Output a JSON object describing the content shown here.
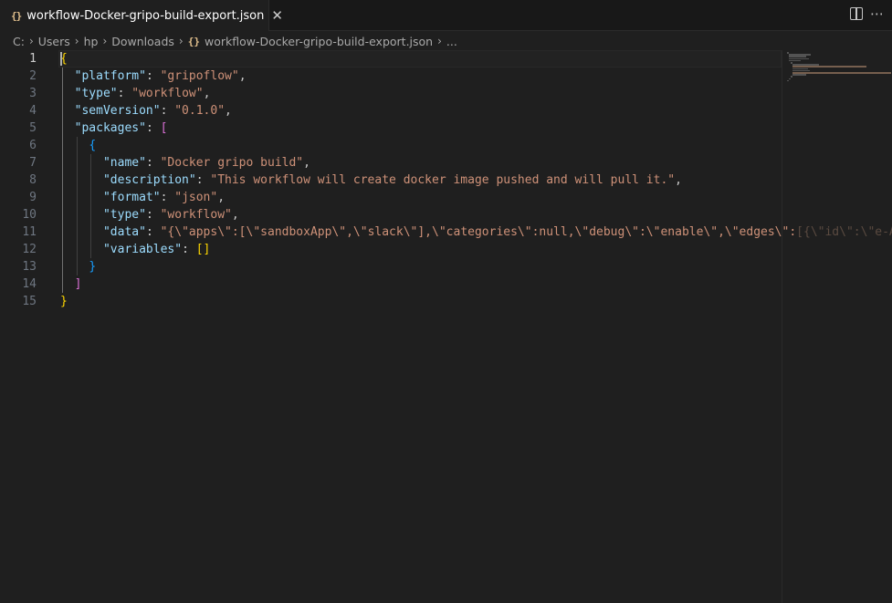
{
  "tab": {
    "icon": "{}",
    "title": "workflow-Docker-gripo-build-export.json"
  },
  "breadcrumb": {
    "items": [
      "C:",
      "Users",
      "hp",
      "Downloads"
    ],
    "file_icon": "{}",
    "file": "workflow-Docker-gripo-build-export.json",
    "more": "..."
  },
  "editor": {
    "active_line": 1,
    "lines": [
      {
        "num": "1",
        "parts": [
          [
            "b1",
            "{"
          ]
        ]
      },
      {
        "num": "2",
        "parts": [
          [
            "p",
            "  "
          ],
          [
            "k",
            "\"platform\""
          ],
          [
            "p",
            ": "
          ],
          [
            "s",
            "\"gripoflow\""
          ],
          [
            "p",
            ","
          ]
        ]
      },
      {
        "num": "3",
        "parts": [
          [
            "p",
            "  "
          ],
          [
            "k",
            "\"type\""
          ],
          [
            "p",
            ": "
          ],
          [
            "s",
            "\"workflow\""
          ],
          [
            "p",
            ","
          ]
        ]
      },
      {
        "num": "4",
        "parts": [
          [
            "p",
            "  "
          ],
          [
            "k",
            "\"semVersion\""
          ],
          [
            "p",
            ": "
          ],
          [
            "s",
            "\"0.1.0\""
          ],
          [
            "p",
            ","
          ]
        ]
      },
      {
        "num": "5",
        "parts": [
          [
            "p",
            "  "
          ],
          [
            "k",
            "\"packages\""
          ],
          [
            "p",
            ": "
          ],
          [
            "b2",
            "["
          ]
        ]
      },
      {
        "num": "6",
        "parts": [
          [
            "p",
            "    "
          ],
          [
            "b3",
            "{"
          ]
        ]
      },
      {
        "num": "7",
        "parts": [
          [
            "p",
            "      "
          ],
          [
            "k",
            "\"name\""
          ],
          [
            "p",
            ": "
          ],
          [
            "s",
            "\"Docker gripo build\""
          ],
          [
            "p",
            ","
          ]
        ]
      },
      {
        "num": "8",
        "parts": [
          [
            "p",
            "      "
          ],
          [
            "k",
            "\"description\""
          ],
          [
            "p",
            ": "
          ],
          [
            "s",
            "\"This workflow will create docker image pushed and will pull it.\""
          ],
          [
            "p",
            ","
          ]
        ]
      },
      {
        "num": "9",
        "parts": [
          [
            "p",
            "      "
          ],
          [
            "k",
            "\"format\""
          ],
          [
            "p",
            ": "
          ],
          [
            "s",
            "\"json\""
          ],
          [
            "p",
            ","
          ]
        ]
      },
      {
        "num": "10",
        "parts": [
          [
            "p",
            "      "
          ],
          [
            "k",
            "\"type\""
          ],
          [
            "p",
            ": "
          ],
          [
            "s",
            "\"workflow\""
          ],
          [
            "p",
            ","
          ]
        ]
      },
      {
        "num": "11",
        "parts": [
          [
            "p",
            "      "
          ],
          [
            "k",
            "\"data\""
          ],
          [
            "p",
            ": "
          ],
          [
            "s",
            "\"{\\\"apps\\\":[\\\"sandboxApp\\\",\\\"slack\\\"],\\\"categories\\\":null,\\\"debug\\\":\\\"enable\\\",\\\"edges\\\":"
          ],
          [
            "fade",
            "[{\\\"id\\\":\\\"e-A"
          ]
        ]
      },
      {
        "num": "12",
        "parts": [
          [
            "p",
            "      "
          ],
          [
            "k",
            "\"variables\""
          ],
          [
            "p",
            ": "
          ],
          [
            "b1",
            "[]"
          ]
        ]
      },
      {
        "num": "13",
        "parts": [
          [
            "p",
            "    "
          ],
          [
            "b3",
            "}"
          ]
        ]
      },
      {
        "num": "14",
        "parts": [
          [
            "p",
            "  "
          ],
          [
            "b2",
            "]"
          ]
        ]
      },
      {
        "num": "15",
        "parts": [
          [
            "b1",
            "}"
          ]
        ]
      }
    ]
  },
  "colors": {
    "background": "#1f1f1f",
    "key": "#9cdcfe",
    "string": "#ce9178",
    "bracket_level1": "#ffd700",
    "bracket_level2": "#da70d6",
    "bracket_level3": "#179fff",
    "json_icon": "#e2c08d"
  },
  "icons": {
    "tab_close": "close-icon",
    "split_editor": "split-editor-icon",
    "more_actions": "more-actions-icon",
    "breadcrumb_separator": "chevron-right-icon"
  }
}
